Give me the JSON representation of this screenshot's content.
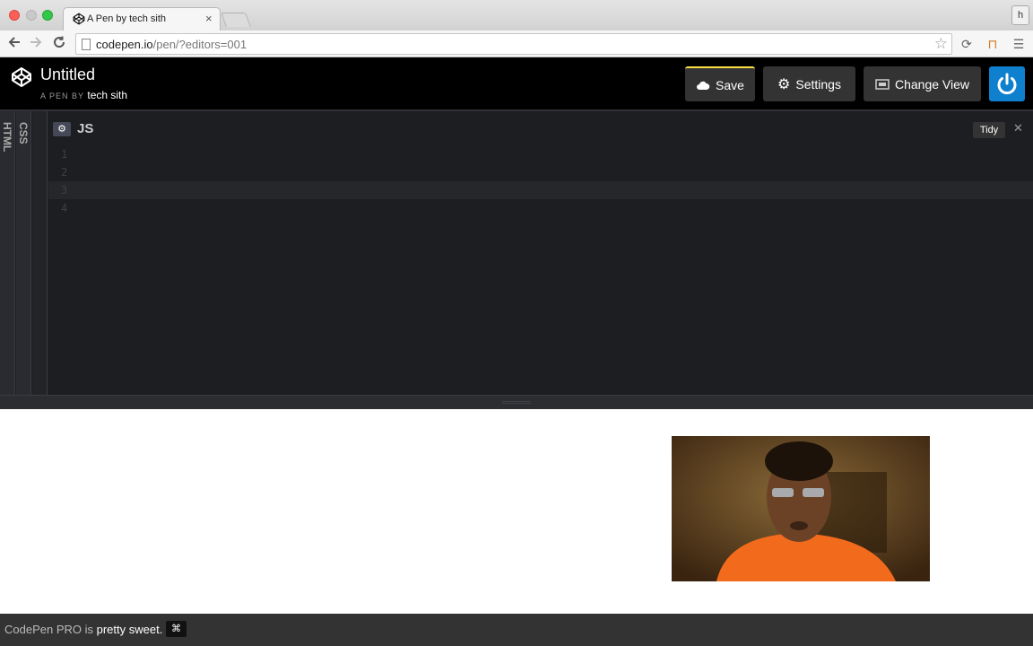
{
  "browser": {
    "tab_title": "A Pen by tech sith",
    "tab_close": "×",
    "profile_initial": "h",
    "url_host": "codepen.io",
    "url_path": "/pen/?editors=001"
  },
  "header": {
    "pen_title": "Untitled",
    "by_label": "A PEN BY",
    "author": "tech sith",
    "save_label": "Save",
    "settings_label": "Settings",
    "change_view_label": "Change View",
    "accent_save": "#ffdd40",
    "accent_power": "#0f80ce"
  },
  "editors": {
    "html_label": "HTML",
    "css_label": "CSS",
    "js_title": "JS",
    "tidy_label": "Tidy",
    "close_label": "✕",
    "gear_glyph": "⚙",
    "line_numbers": [
      "1",
      "2",
      "3",
      "4"
    ],
    "active_line": 3
  },
  "footer": {
    "prefix": "CodePen PRO is",
    "emphasis": "pretty sweet.",
    "key_glyph": "⌘"
  }
}
